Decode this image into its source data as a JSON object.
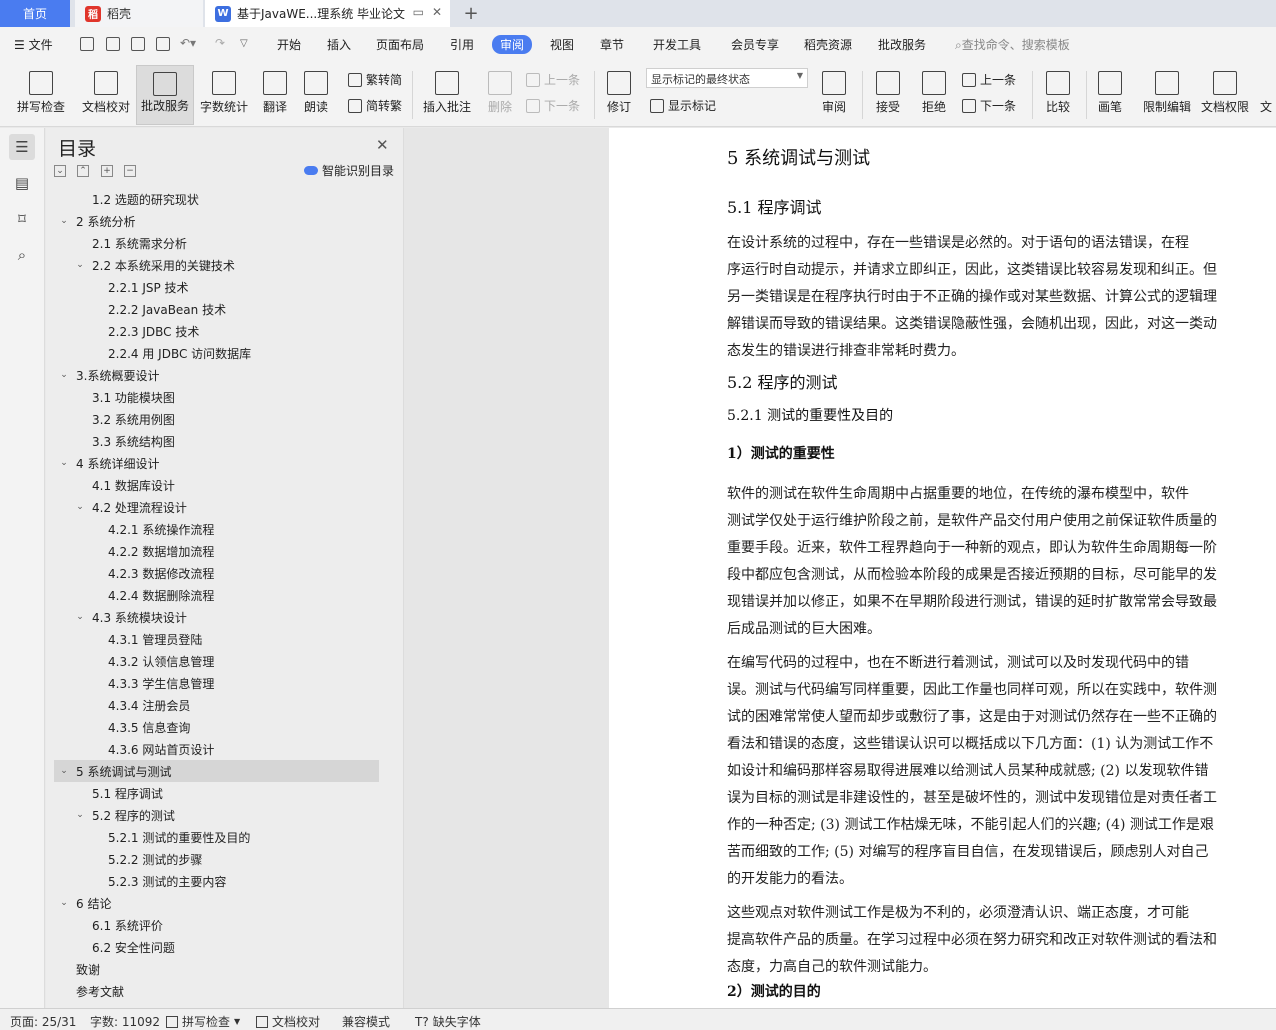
{
  "tabs": {
    "home": "首页",
    "docer": "稻壳",
    "doc": "基于JavaWE...理系统 毕业论文"
  },
  "menu": {
    "file": "文件",
    "items": [
      "开始",
      "插入",
      "页面布局",
      "引用",
      "审阅",
      "视图",
      "章节",
      "开发工具",
      "会员专享",
      "稻壳资源",
      "批改服务"
    ],
    "active": "审阅",
    "search": "查找命令、搜索模板"
  },
  "ribbon": {
    "spellcheck": "拼写检查",
    "doccheck": "文档校对",
    "review_service": "批改服务",
    "wordcount": "字数统计",
    "translate": "翻译",
    "read_aloud": "朗读",
    "trad_simp": "繁转简",
    "simp_trad": "简转繁",
    "insert_comment": "插入批注",
    "delete": "删除",
    "prev_comment": "上一条",
    "next_comment": "下一条",
    "revise": "修订",
    "markup_state": "显示标记的最终状态",
    "show_markup": "显示标记",
    "review_pane": "审阅",
    "accept": "接受",
    "reject": "拒绝",
    "prev_change": "上一条",
    "next_change": "下一条",
    "compare": "比较",
    "ink": "画笔",
    "restrict": "限制编辑",
    "permission": "文档权限",
    "more": "文"
  },
  "toc": {
    "title": "目录",
    "smart": "智能识别目录",
    "items": [
      {
        "label": "1.2  选题的研究现状",
        "level": 2,
        "arrow": ""
      },
      {
        "label": "2  系统分析",
        "level": 1,
        "arrow": "v"
      },
      {
        "label": "2.1  系统需求分析",
        "level": 2,
        "arrow": ""
      },
      {
        "label": "2.2  本系统采用的关键技术",
        "level": 2,
        "arrow": "v"
      },
      {
        "label": "2.2.1    JSP 技术",
        "level": 3,
        "arrow": ""
      },
      {
        "label": "2.2.2    JavaBean 技术",
        "level": 3,
        "arrow": ""
      },
      {
        "label": "2.2.3    JDBC 技术",
        "level": 3,
        "arrow": ""
      },
      {
        "label": "2.2.4    用 JDBC 访问数据库",
        "level": 3,
        "arrow": ""
      },
      {
        "label": "3.系统概要设计",
        "level": 1,
        "arrow": "v"
      },
      {
        "label": "3.1 功能模块图",
        "level": 2,
        "arrow": ""
      },
      {
        "label": "3.2 系统用例图",
        "level": 2,
        "arrow": ""
      },
      {
        "label": "3.3 系统结构图",
        "level": 2,
        "arrow": ""
      },
      {
        "label": "4  系统详细设计",
        "level": 1,
        "arrow": "v"
      },
      {
        "label": "4.1 数据库设计",
        "level": 2,
        "arrow": ""
      },
      {
        "label": "4.2  处理流程设计",
        "level": 2,
        "arrow": "v"
      },
      {
        "label": "4.2.1    系统操作流程",
        "level": 3,
        "arrow": ""
      },
      {
        "label": "4.2.2    数据增加流程",
        "level": 3,
        "arrow": ""
      },
      {
        "label": "4.2.3    数据修改流程",
        "level": 3,
        "arrow": ""
      },
      {
        "label": "4.2.4    数据删除流程",
        "level": 3,
        "arrow": ""
      },
      {
        "label": "4.3  系统模块设计",
        "level": 2,
        "arrow": "v"
      },
      {
        "label": "4.3.1    管理员登陆",
        "level": 3,
        "arrow": ""
      },
      {
        "label": "4.3.2    认领信息管理",
        "level": 3,
        "arrow": ""
      },
      {
        "label": "4.3.3    学生信息管理",
        "level": 3,
        "arrow": ""
      },
      {
        "label": "4.3.4    注册会员",
        "level": 3,
        "arrow": ""
      },
      {
        "label": "4.3.5    信息查询",
        "level": 3,
        "arrow": ""
      },
      {
        "label": "4.3.6    网站首页设计",
        "level": 3,
        "arrow": ""
      },
      {
        "label": "5  系统调试与测试",
        "level": 1,
        "arrow": "v",
        "selected": true
      },
      {
        "label": "5.1  程序调试",
        "level": 2,
        "arrow": ""
      },
      {
        "label": "5.2  程序的测试",
        "level": 2,
        "arrow": "v"
      },
      {
        "label": "5.2.1    测试的重要性及目的",
        "level": 3,
        "arrow": ""
      },
      {
        "label": "5.2.2    测试的步骤",
        "level": 3,
        "arrow": ""
      },
      {
        "label": "5.2.3    测试的主要内容",
        "level": 3,
        "arrow": ""
      },
      {
        "label": "6  结论",
        "level": 1,
        "arrow": "v"
      },
      {
        "label": "6.1  系统评价",
        "level": 2,
        "arrow": ""
      },
      {
        "label": "6.2  安全性问题",
        "level": 2,
        "arrow": ""
      },
      {
        "label": "致谢",
        "level": 1,
        "arrow": ""
      },
      {
        "label": "参考文献",
        "level": 1,
        "arrow": ""
      }
    ]
  },
  "document": {
    "lines": [
      {
        "text": "5  系统调试与测试",
        "style": "h1"
      },
      {
        "text": "5.1  程序调试",
        "style": "h2"
      },
      {
        "text": "      在设计系统的过程中，存在一些错误是必然的。对于语句的语法错误，在程",
        "style": "p"
      },
      {
        "text": "序运行时自动提示，并请求立即纠正，因此，这类错误比较容易发现和纠正。但",
        "style": "p"
      },
      {
        "text": "另一类错误是在程序执行时由于不正确的操作或对某些数据、计算公式的逻辑理",
        "style": "p"
      },
      {
        "text": "解错误而导致的错误结果。这类错误隐蔽性强，会随机出现，因此，对这一类动",
        "style": "p"
      },
      {
        "text": "态发生的错误进行排查非常耗时费力。",
        "style": "p"
      },
      {
        "text": "5.2  程序的测试",
        "style": "h2"
      },
      {
        "text": "5.2.1    测试的重要性及目的",
        "style": "h3"
      },
      {
        "text": "    1）测试的重要性",
        "style": "h4"
      },
      {
        "text": "      软件的测试在软件生命周期中占据重要的地位，在传统的瀑布模型中，软件",
        "style": "p"
      },
      {
        "text": "测试学仅处于运行维护阶段之前，是软件产品交付用户使用之前保证软件质量的",
        "style": "p"
      },
      {
        "text": "重要手段。近来，软件工程界趋向于一种新的观点，即认为软件生命周期每一阶",
        "style": "p"
      },
      {
        "text": "段中都应包含测试，从而检验本阶段的成果是否接近预期的目标，尽可能早的发",
        "style": "p"
      },
      {
        "text": "现错误并加以修正，如果不在早期阶段进行测试，错误的延时扩散常常会导致最",
        "style": "p"
      },
      {
        "text": "后成品测试的巨大困难。",
        "style": "p"
      },
      {
        "text": "      在编写代码的过程中，也在不断进行着测试，测试可以及时发现代码中的错",
        "style": "p"
      },
      {
        "text": "误。测试与代码编写同样重要，因此工作量也同样可观，所以在实践中，软件测",
        "style": "p"
      },
      {
        "text": "试的困难常常使人望而却步或敷衍了事，这是由于对测试仍然存在一些不正确的",
        "style": "p"
      },
      {
        "text": "看法和错误的态度，这些错误认识可以概括成以下几方面：(1) 认为测试工作不",
        "style": "p"
      },
      {
        "text": "如设计和编码那样容易取得进展难以给测试人员某种成就感; (2) 以发现软件错",
        "style": "p"
      },
      {
        "text": "误为目标的测试是非建设性的，甚至是破坏性的，测试中发现错位是对责任者工",
        "style": "p"
      },
      {
        "text": "作的一种否定; (3) 测试工作枯燥无味，不能引起人们的兴趣; (4) 测试工作是艰",
        "style": "p"
      },
      {
        "text": "苦而细致的工作; (5) 对编写的程序盲目自信，在发现错误后，顾虑别人对自己",
        "style": "p"
      },
      {
        "text": "的开发能力的看法。",
        "style": "p"
      },
      {
        "text": "      这些观点对软件测试工作是极为不利的，必须澄清认识、端正态度，才可能",
        "style": "p"
      },
      {
        "text": "提高软件产品的质量。在学习过程中必须在努力研究和改正对软件测试的看法和",
        "style": "p"
      },
      {
        "text": "态度，力高自己的软件测试能力。",
        "style": "p"
      },
      {
        "text": "    2）测试的目的",
        "style": "h4"
      }
    ]
  },
  "status": {
    "page": "页面: 25/31",
    "words": "字数: 11092",
    "spell": "拼写检查",
    "doccheck": "文档校对",
    "compat": "兼容模式",
    "missing_font": "缺失字体"
  }
}
